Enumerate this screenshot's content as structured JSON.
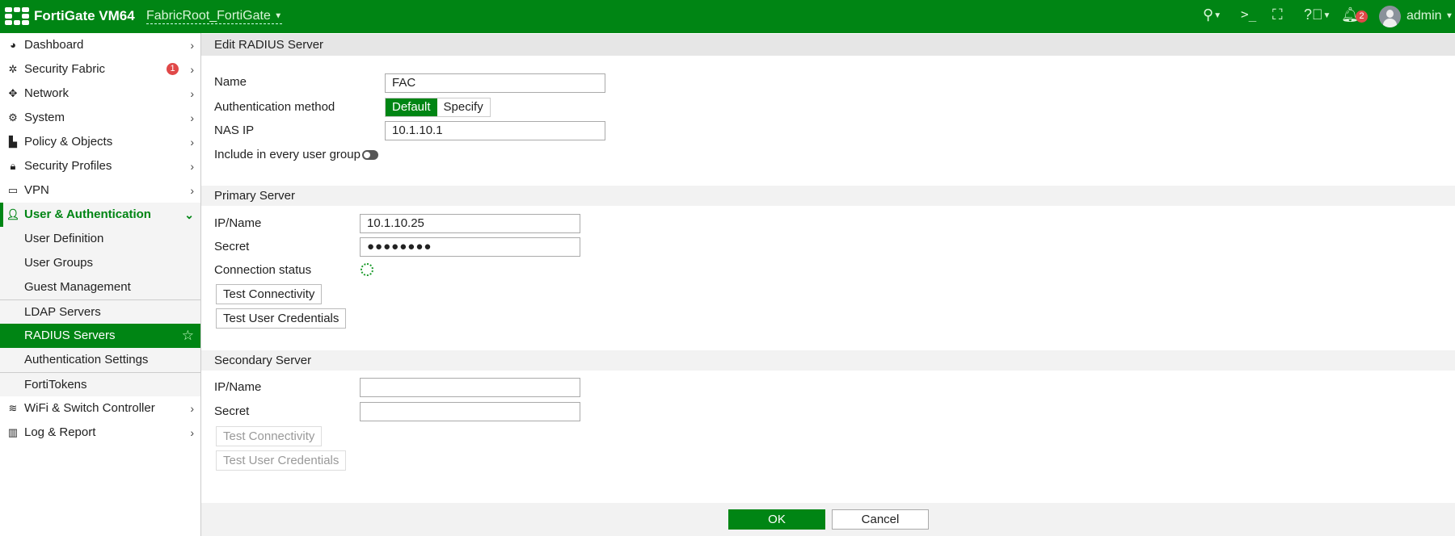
{
  "header": {
    "product": "FortiGate VM64",
    "vdom": "FabricRoot_FortiGate",
    "notifications": "2",
    "user": "admin",
    "icons": [
      "search-icon",
      "cli-console-icon",
      "fullscreen-icon",
      "help-icon",
      "bell-icon"
    ]
  },
  "sidebar": {
    "items": [
      {
        "label": "Dashboard",
        "icon": "dashboard-icon"
      },
      {
        "label": "Security Fabric",
        "icon": "security-fabric-icon",
        "badge": "1"
      },
      {
        "label": "Network",
        "icon": "network-icon"
      },
      {
        "label": "System",
        "icon": "gear-icon"
      },
      {
        "label": "Policy & Objects",
        "icon": "policy-icon"
      },
      {
        "label": "Security Profiles",
        "icon": "lock-icon"
      },
      {
        "label": "VPN",
        "icon": "laptop-icon"
      },
      {
        "label": "User & Authentication",
        "icon": "user-icon"
      },
      {
        "label": "User Definition"
      },
      {
        "label": "User Groups"
      },
      {
        "label": "Guest Management"
      },
      {
        "label": "LDAP Servers"
      },
      {
        "label": "RADIUS Servers"
      },
      {
        "label": "Authentication Settings"
      },
      {
        "label": "FortiTokens"
      },
      {
        "label": "WiFi & Switch Controller",
        "icon": "wifi-icon"
      },
      {
        "label": "Log & Report",
        "icon": "chart-icon"
      }
    ]
  },
  "form": {
    "title": "Edit RADIUS Server",
    "name_label": "Name",
    "name_value": "FAC",
    "auth_label": "Authentication method",
    "auth_options": [
      "Default",
      "Specify"
    ],
    "auth_selected": "Default",
    "nas_label": "NAS IP",
    "nas_value": "10.1.10.1",
    "include_label": "Include in every user group",
    "include_enabled": false,
    "primary": {
      "title": "Primary Server",
      "ip_label": "IP/Name",
      "ip_value": "10.1.10.25",
      "secret_label": "Secret",
      "secret_value": "●●●●●●●●",
      "status_label": "Connection status",
      "test_conn": "Test Connectivity",
      "test_cred": "Test User Credentials"
    },
    "secondary": {
      "title": "Secondary Server",
      "ip_label": "IP/Name",
      "ip_value": "",
      "secret_label": "Secret",
      "secret_value": "",
      "test_conn": "Test Connectivity",
      "test_cred": "Test User Credentials"
    }
  },
  "footer": {
    "ok": "OK",
    "cancel": "Cancel"
  },
  "colors": {
    "brand": "#008514",
    "badge": "#e04848"
  }
}
